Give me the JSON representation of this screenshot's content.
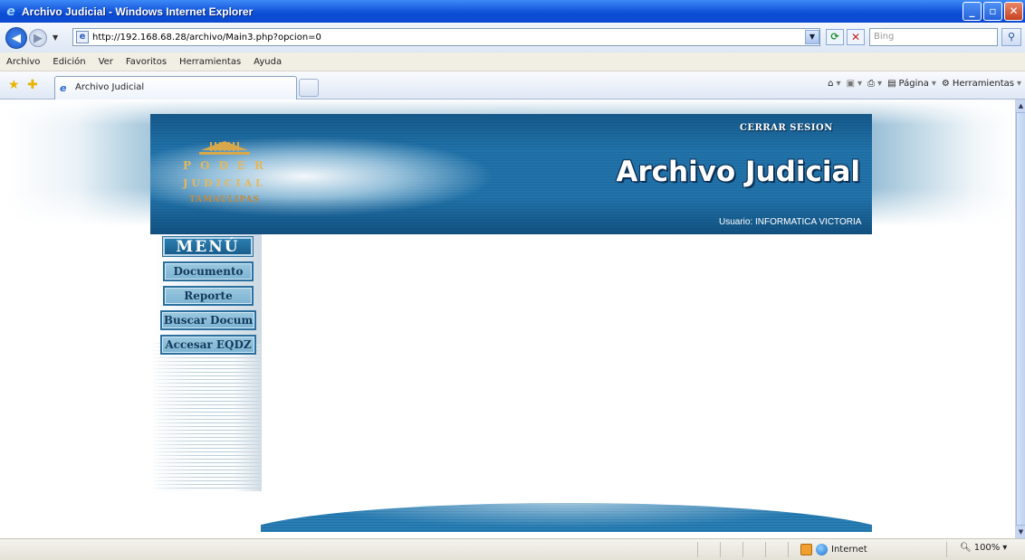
{
  "window": {
    "title": "Archivo Judicial - Windows Internet Explorer",
    "min_icon": "minimize-icon",
    "max_icon": "maximize-icon",
    "close_icon": "close-icon"
  },
  "address_bar": {
    "url": "http://192.168.68.28/archivo/Main3.php?opcion=0",
    "search_placeholder": "Bing"
  },
  "menu_bar": {
    "items": [
      "Archivo",
      "Edición",
      "Ver",
      "Favoritos",
      "Herramientas",
      "Ayuda"
    ]
  },
  "tabs": {
    "active_label": "Archivo Judicial"
  },
  "command_bar": {
    "page_label": "Página",
    "tools_label": "Herramientas"
  },
  "page": {
    "logo": {
      "line1": "PODER",
      "line2": "JUDICIAL",
      "line3": "TAMAULIPAS"
    },
    "logout_label": "CERRAR SESION",
    "app_title": "Archivo Judicial",
    "user_text": "Usuario: INFORMATICA VICTORIA",
    "menu_title": "MENÚ",
    "menu_items": [
      "Documento",
      "Reporte",
      "Buscar Docum",
      "Accesar EQDZ"
    ]
  },
  "status_bar": {
    "zone": "Internet",
    "zoom": "100%"
  },
  "colors": {
    "titlebar": "#0a4ed6",
    "header_blue": "#1d6aa0",
    "menu_button": "#9bc8e0",
    "logo_gold": "#d8a84a"
  }
}
